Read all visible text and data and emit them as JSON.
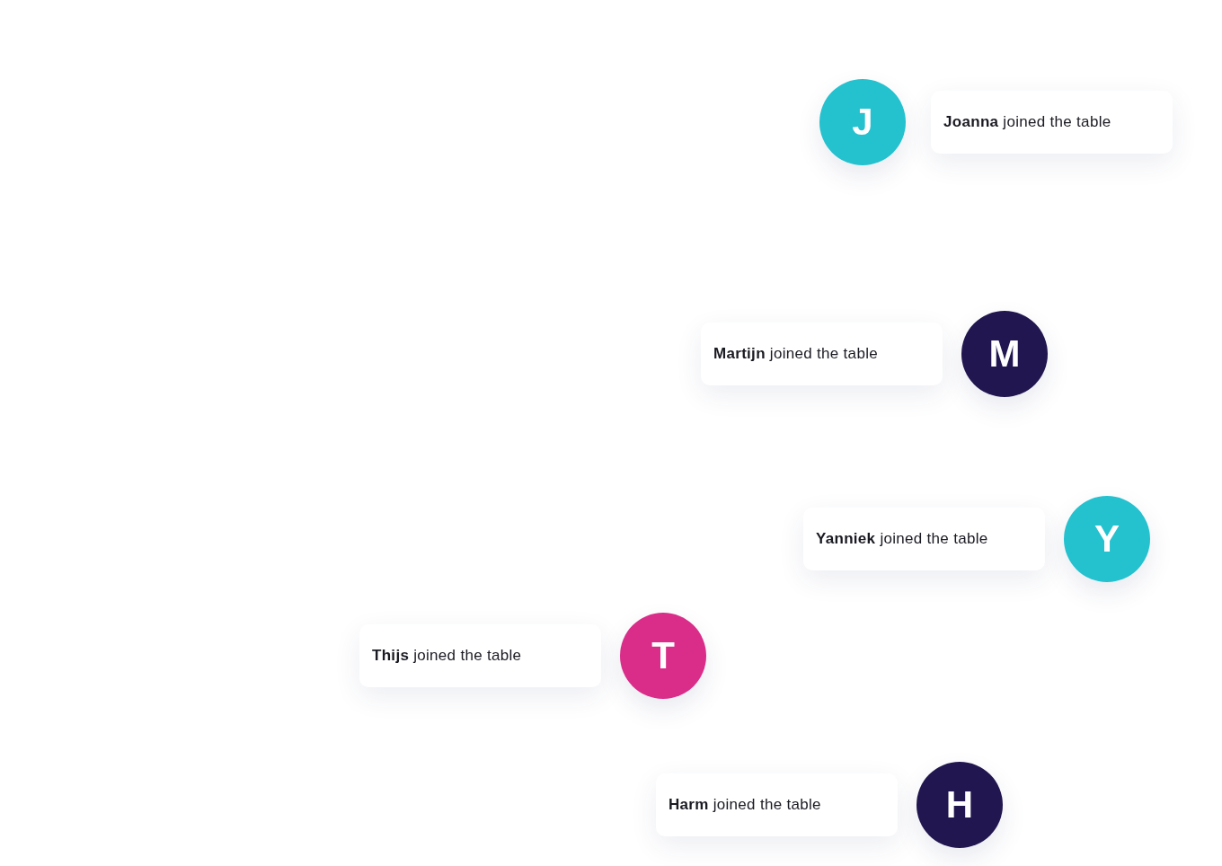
{
  "notifications": [
    {
      "initial": "J",
      "color": "#24c1cf",
      "message": "**Joanna** joined the table"
    },
    {
      "initial": "M",
      "color": "#21164f",
      "message": "**Martijn** joined the table"
    },
    {
      "initial": "Y",
      "color": "#24c1cf",
      "message": "**Yanniek** joined the table"
    },
    {
      "initial": "T",
      "color": "#d92d89",
      "message": "**Thijs** joined the table"
    },
    {
      "initial": "H",
      "color": "#21164f",
      "message": "**Harm** joined the table"
    }
  ]
}
